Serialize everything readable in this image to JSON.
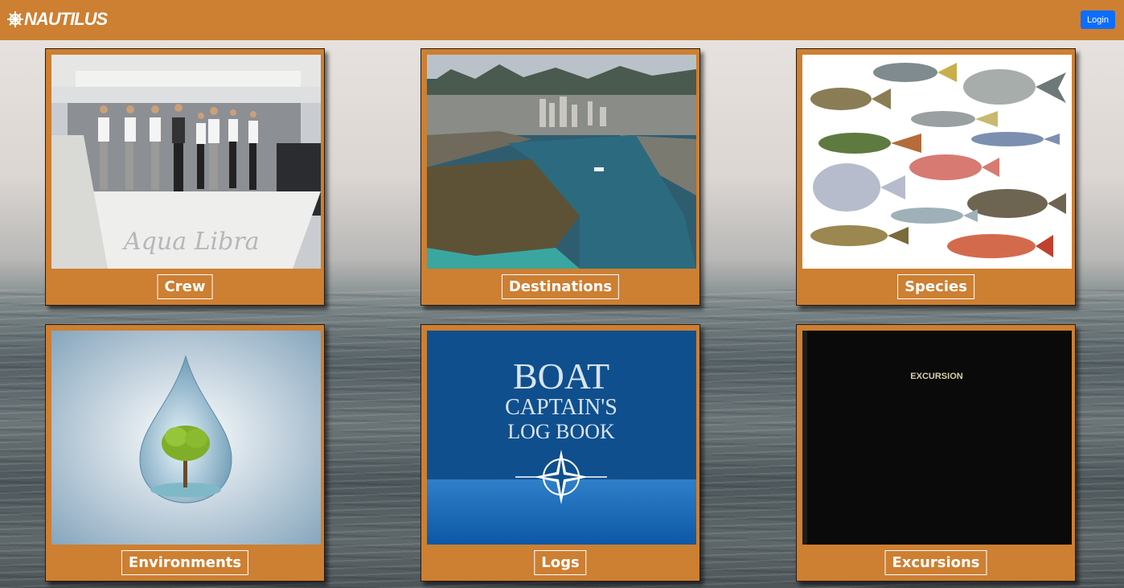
{
  "header": {
    "brand": "NAUTILUS",
    "login_label": "Login"
  },
  "cards": [
    {
      "label": "Crew",
      "image": "crew-photo"
    },
    {
      "label": "Destinations",
      "image": "harbor-aerial-photo"
    },
    {
      "label": "Species",
      "image": "fish-species-illustration"
    },
    {
      "label": "Environments",
      "image": "water-drop-tree-image"
    },
    {
      "label": "Logs",
      "image": "log-book-cover"
    },
    {
      "label": "Excursions",
      "image": "excursion-book-cover"
    }
  ],
  "images": {
    "crew_text": "Aqua Libra",
    "logbook_lines": [
      "BOAT",
      "CAPTAIN'S",
      "LOG BOOK"
    ],
    "excursion_cover_text": "EXCURSION"
  },
  "colors": {
    "accent": "#cd7f32",
    "login": "#0d6efd"
  }
}
